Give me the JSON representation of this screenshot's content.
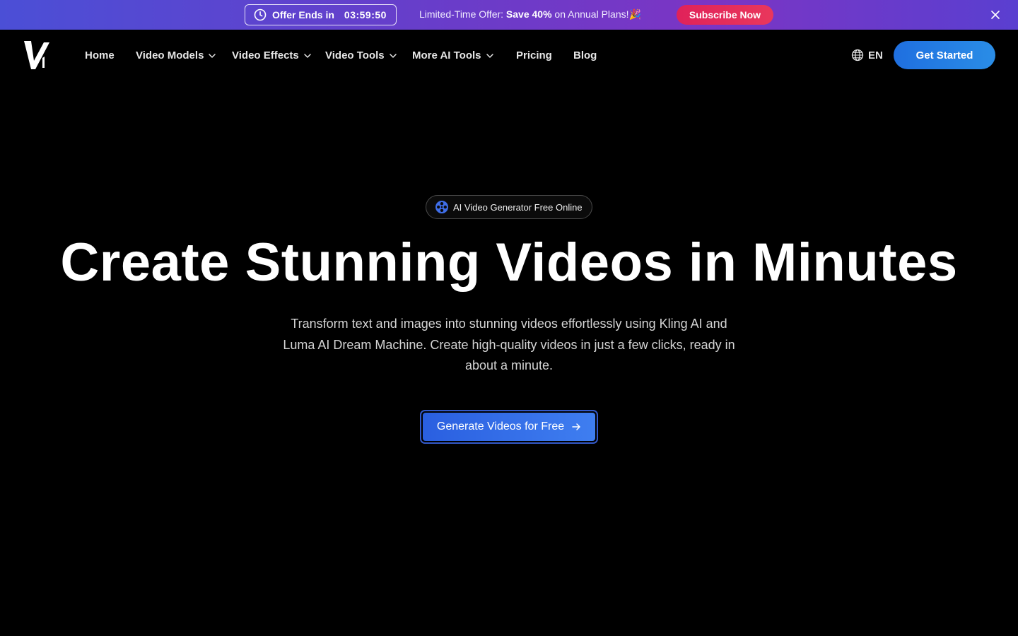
{
  "banner": {
    "timer_label": "Offer Ends in",
    "timer_value": "03:59:50",
    "offer_prefix": "Limited-Time Offer:",
    "offer_bold": "Save 40%",
    "offer_suffix": "on Annual Plans!",
    "offer_emoji": "🎉",
    "subscribe_label": "Subscribe Now",
    "close_icon": "close-icon"
  },
  "nav": {
    "logo_icon": "v1-logo",
    "items": [
      {
        "label": "Home",
        "dropdown": false
      },
      {
        "label": "Video Models",
        "dropdown": true
      },
      {
        "label": "Video Effects",
        "dropdown": true
      },
      {
        "label": "Video Tools",
        "dropdown": true
      },
      {
        "label": "More AI Tools",
        "dropdown": true
      },
      {
        "label": "Pricing",
        "dropdown": false
      },
      {
        "label": "Blog",
        "dropdown": false
      }
    ],
    "language": "EN",
    "get_started_label": "Get Started"
  },
  "hero": {
    "badge_label": "AI Video Generator Free Online",
    "title": "Create Stunning Videos in Minutes",
    "subtitle": "Transform text and images into stunning videos effortlessly using Kling AI and Luma AI Dream Machine. Create high-quality videos in just a few clicks, ready in about a minute.",
    "cta_label": "Generate Videos for Free"
  },
  "colors": {
    "background": "#000000",
    "banner_start": "#4b4fd6",
    "banner_end": "#7b35c4",
    "subscribe": "#e0225a",
    "accent_blue": "#1f6fe0",
    "cta_blue": "#2a5fe0"
  }
}
